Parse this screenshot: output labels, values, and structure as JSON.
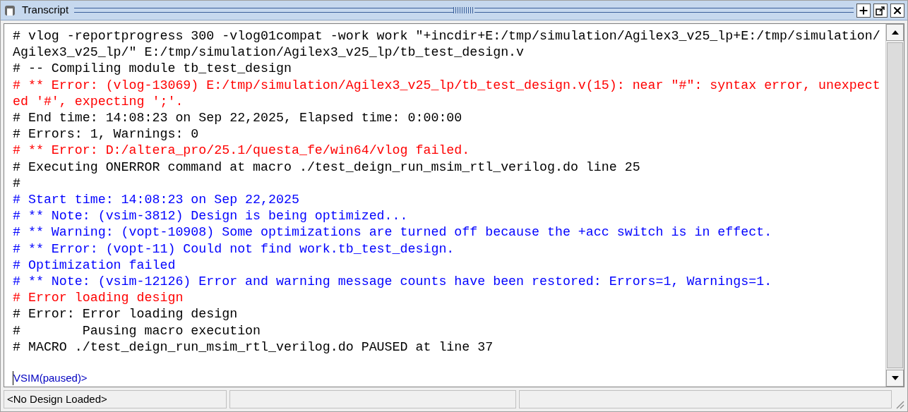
{
  "window": {
    "title": "Transcript"
  },
  "transcript": {
    "lines": [
      {
        "kind": "normal",
        "text": "# vlog -reportprogress 300 -vlog01compat -work work \"+incdir+E:/tmp/simulation/Agilex3_v25_lp+E:/tmp/simulation/"
      },
      {
        "kind": "normal",
        "text": "Agilex3_v25_lp/\" E:/tmp/simulation/Agilex3_v25_lp/tb_test_design.v"
      },
      {
        "kind": "normal",
        "text": "# -- Compiling module tb_test_design"
      },
      {
        "kind": "error",
        "text": "# ** Error: (vlog-13069) E:/tmp/simulation/Agilex3_v25_lp/tb_test_design.v(15): near \"#\": syntax error, unexpect"
      },
      {
        "kind": "error",
        "text": "ed '#', expecting ';'."
      },
      {
        "kind": "normal",
        "text": "# End time: 14:08:23 on Sep 22,2025, Elapsed time: 0:00:00"
      },
      {
        "kind": "normal",
        "text": "# Errors: 1, Warnings: 0"
      },
      {
        "kind": "error",
        "text": "# ** Error: D:/altera_pro/25.1/questa_fe/win64/vlog failed."
      },
      {
        "kind": "normal",
        "text": "# Executing ONERROR command at macro ./test_deign_run_msim_rtl_verilog.do line 25"
      },
      {
        "kind": "normal",
        "text": "#"
      },
      {
        "kind": "note",
        "text": "# Start time: 14:08:23 on Sep 22,2025"
      },
      {
        "kind": "note",
        "text": "# ** Note: (vsim-3812) Design is being optimized..."
      },
      {
        "kind": "note",
        "text": "# ** Warning: (vopt-10908) Some optimizations are turned off because the +acc switch is in effect."
      },
      {
        "kind": "note",
        "text": "# ** Error: (vopt-11) Could not find work.tb_test_design."
      },
      {
        "kind": "note",
        "text": "# Optimization failed"
      },
      {
        "kind": "note",
        "text": "# ** Note: (vsim-12126) Error and warning message counts have been restored: Errors=1, Warnings=1."
      },
      {
        "kind": "error",
        "text": "# Error loading design"
      },
      {
        "kind": "normal",
        "text": "# Error: Error loading design"
      },
      {
        "kind": "normal",
        "text": "#        Pausing macro execution"
      },
      {
        "kind": "normal",
        "text": "# MACRO ./test_deign_run_msim_rtl_verilog.do PAUSED at line 37"
      }
    ],
    "prompt": "VSIM(paused)>"
  },
  "status_bar": {
    "panels": [
      "<No Design Loaded>"
    ]
  }
}
